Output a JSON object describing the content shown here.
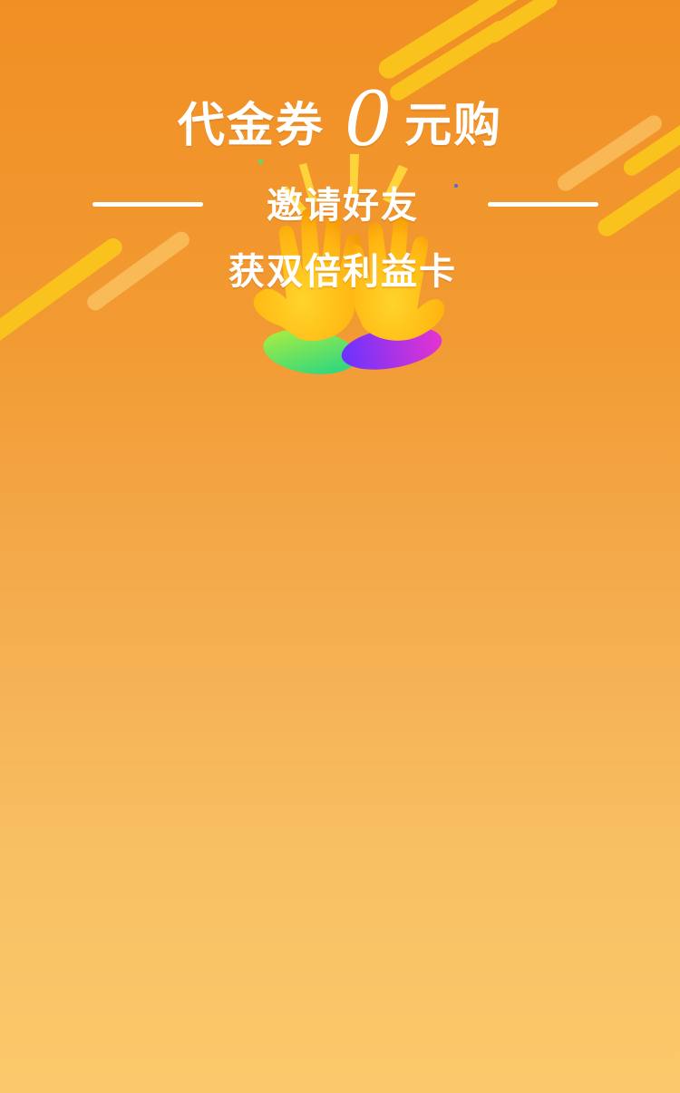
{
  "promo": {
    "title_prefix": "代金券",
    "title_zero": "0",
    "title_suffix": "元购",
    "subtitle_line1": "邀请好友",
    "subtitle_line2": "获双倍利益卡"
  },
  "colors": {
    "background_top": "#f08f24",
    "background_bottom": "#fac86a",
    "stripe": "#f9c21c",
    "text": "#ffffff"
  },
  "illustration": {
    "name": "high-five-hands-icon"
  }
}
